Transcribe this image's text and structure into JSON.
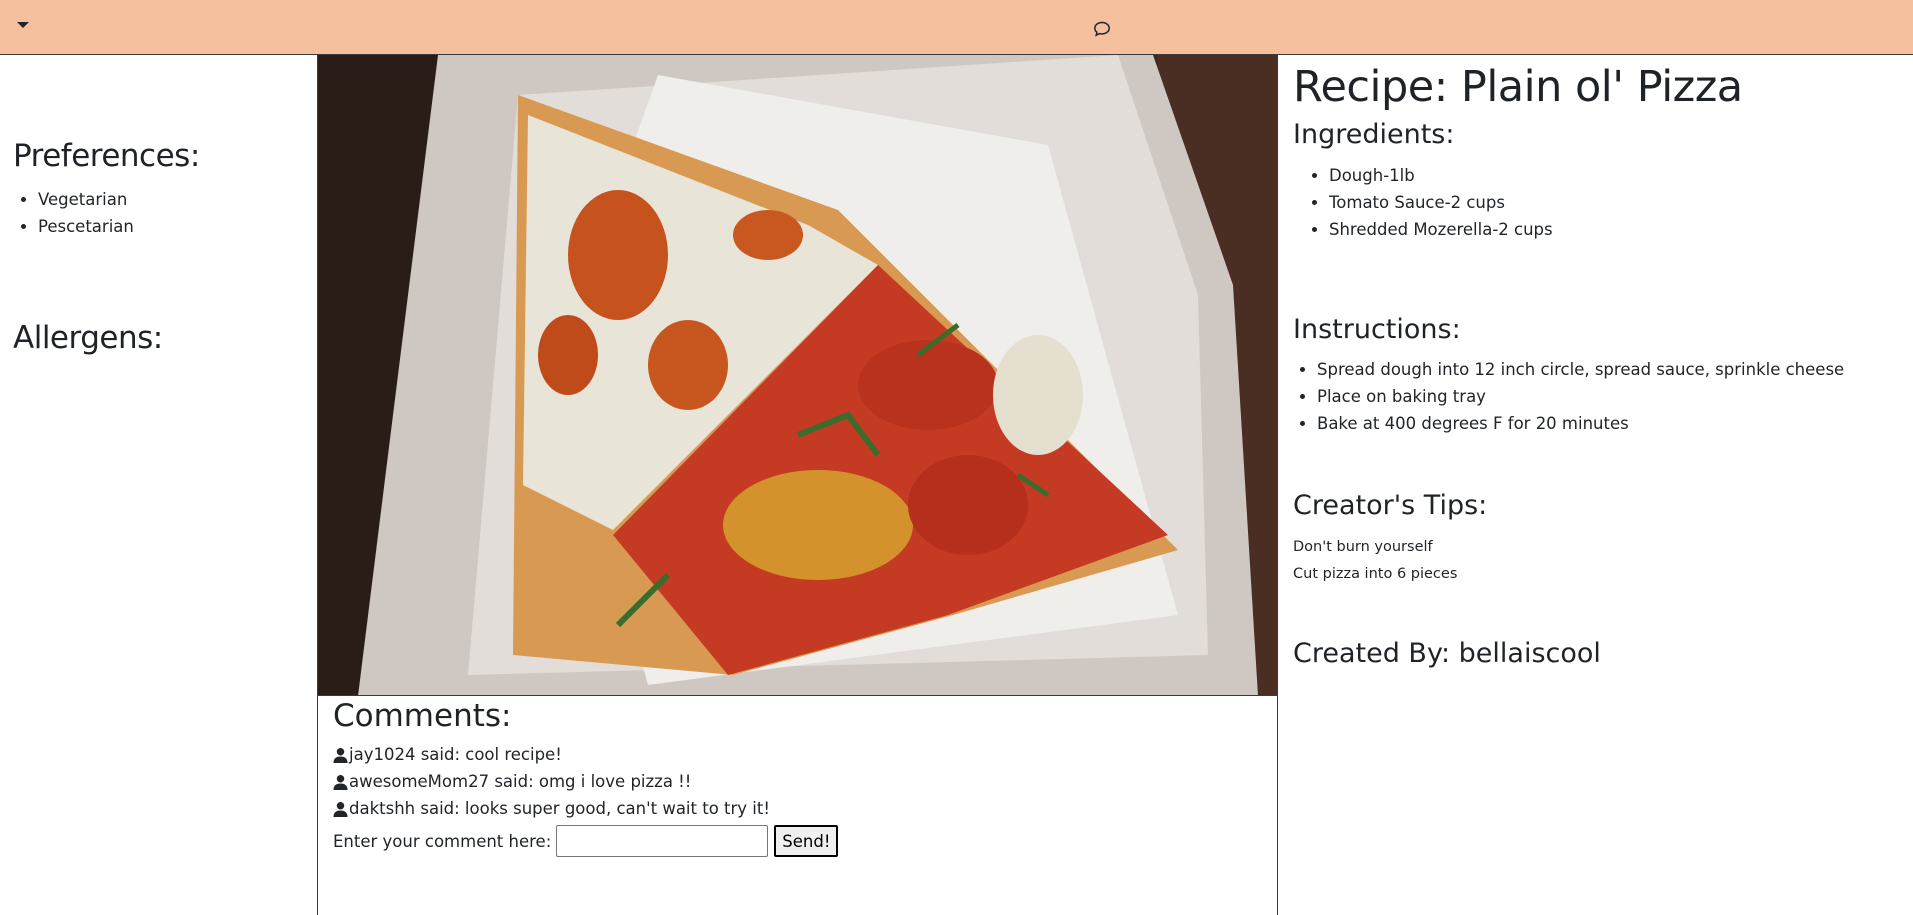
{
  "header": {
    "menu_icon": "caret-down-icon",
    "chat_icon": "chat-bubble-icon",
    "background": "#f4c09e"
  },
  "preferences": {
    "title": "Preferences:",
    "items": [
      "Vegetarian",
      "Pescetarian"
    ]
  },
  "allergens": {
    "title": "Allergens:"
  },
  "comments": {
    "title": "Comments:",
    "items": [
      {
        "text": "jay1024 said: cool recipe!"
      },
      {
        "text": "awesomeMom27 said: omg i love pizza !!"
      },
      {
        "text": "daktshh said: looks super good, can't wait to try it!"
      }
    ],
    "prompt": "Enter your comment here:",
    "input_value": "",
    "send_label": "Send!"
  },
  "recipe": {
    "title": "Recipe: Plain ol' Pizza",
    "ingredients_title": "Ingredients:",
    "ingredients": [
      "Dough-1lb",
      "Tomato Sauce-2 cups",
      "Shredded Mozerella-2 cups"
    ],
    "instructions_title": "Instructions:",
    "instructions": [
      "Spread dough into 12 inch circle, spread sauce, sprinkle cheese",
      "Place on baking tray",
      "Bake at 400 degrees F for 20 minutes"
    ],
    "tips_title": "Creator's Tips:",
    "tips": [
      "Don't burn yourself",
      "Cut pizza into 6 pieces"
    ],
    "created_by": "Created By: bellaiscool"
  }
}
